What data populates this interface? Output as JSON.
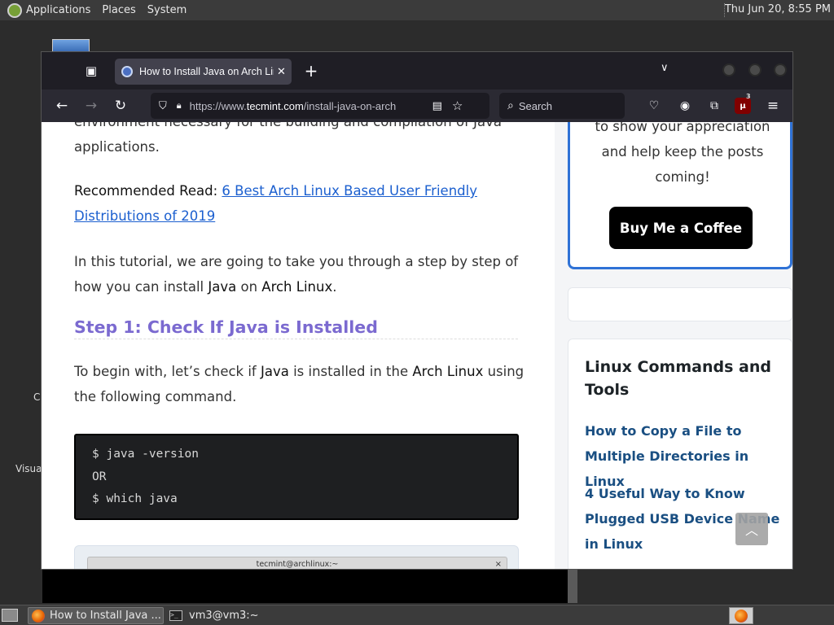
{
  "top_panel": {
    "menus": [
      "Applications",
      "Places",
      "System"
    ],
    "clock": "Thu Jun 20,  8:55 PM"
  },
  "desktop": {
    "labels": [
      "C",
      "Visua"
    ]
  },
  "browser": {
    "tab": {
      "title": "How to Install Java on Arch Linux",
      "close_glyph": "✕"
    },
    "url": {
      "prefix": "https://www.",
      "domain": "tecmint.com",
      "path": "/install-java-on-arch"
    },
    "search_placeholder": "Search",
    "extension_badge": "3"
  },
  "article": {
    "intro_tail_1": "environment necessary for the building and compilation of Java",
    "intro_tail_2": "applications.",
    "recommended_label": "Recommended Read:",
    "recommended_link_1": "6 Best Arch Linux Based User Friendly",
    "recommended_link_2": "Distributions of 2019",
    "tutorial_p1": "In this tutorial, we are going to take you through a step by step of",
    "tutorial_p2a": "how you can install ",
    "tutorial_java": "Java",
    "tutorial_on": " on ",
    "tutorial_arch": "Arch Linux",
    "tutorial_dot": ".",
    "step_heading": "Step 1: Check If Java is Installed",
    "begin_a": "To begin with, let’s check if ",
    "begin_java": "Java",
    "begin_b": " is installed in the ",
    "begin_arch": "Arch Linux",
    "begin_c": " using",
    "begin_line2": "the following command.",
    "code_lines": [
      "$ java -version",
      "OR",
      "$ which java"
    ],
    "screenshot_title": "tecmint@archlinux:~",
    "screenshot_close": "×"
  },
  "sidebar": {
    "donate_line1": "to show your appreciation",
    "donate_line2": "and help keep the posts",
    "donate_line3": "coming!",
    "coffee_button": "Buy Me a Coffee",
    "widget_title": "Linux Commands and Tools",
    "links": [
      "How to Copy a File to Multiple Directories in Linux",
      "4 Useful Way to Know Plugged USB Device Name in Linux"
    ]
  },
  "taskbar": {
    "tasks": [
      {
        "label": "How to Install Java ..."
      },
      {
        "label": "vm3@vm3:~"
      }
    ]
  }
}
